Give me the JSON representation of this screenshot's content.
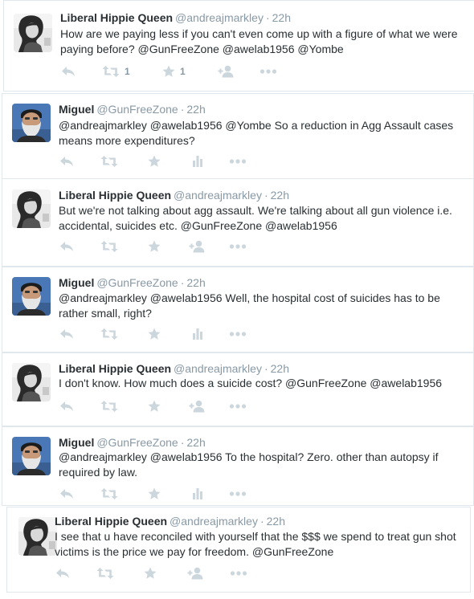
{
  "colors": {
    "name": "#292f33",
    "meta": "#8899a6",
    "action_icon": "#ccd6dd",
    "border": "#e1e8ed"
  },
  "icons": {
    "reply": "reply-icon",
    "retweet": "retweet-icon",
    "favorite": "star-icon",
    "analytics": "bar-chart-icon",
    "follow": "follow-icon",
    "more": "more-icon"
  },
  "tweets": [
    {
      "name": "Liberal Hippie Queen",
      "handle": "@andreajmarkley",
      "dot": "·",
      "time": "22h",
      "text": "How are we paying less if you can't even come up with a figure of what we were paying before? @GunFreeZone @awelab1956 @Yombe",
      "retweet_count": "1",
      "favorite_count": "1"
    },
    {
      "name": "Miguel",
      "handle": "@GunFreeZone",
      "dot": "·",
      "time": "22h",
      "text": "@andreajmarkley @awelab1956 @Yombe So a reduction in Agg Assault cases means more expenditures?"
    },
    {
      "name": "Liberal Hippie Queen",
      "handle": "@andreajmarkley",
      "dot": "·",
      "time": "22h",
      "text": "But we're not talking about agg assault. We're talking about all gun violence i.e. accidental, suicides etc. @GunFreeZone @awelab1956"
    },
    {
      "name": "Miguel",
      "handle": "@GunFreeZone",
      "dot": "·",
      "time": "22h",
      "text": "@andreajmarkley @awelab1956 Well, the hospital cost of suicides has to be rather small, right?"
    },
    {
      "name": "Liberal Hippie Queen",
      "handle": "@andreajmarkley",
      "dot": "·",
      "time": "22h",
      "text": "I don't know. How much does a suicide cost? @GunFreeZone @awelab1956"
    },
    {
      "name": "Miguel",
      "handle": "@GunFreeZone",
      "dot": "·",
      "time": "22h",
      "text": "@andreajmarkley @awelab1956 To the hospital? Zero. other than autopsy if required by law."
    },
    {
      "name": "Liberal Hippie Queen",
      "handle": "@andreajmarkley",
      "dot": "·",
      "time": "22h",
      "text": "I see that u have reconciled with yourself that the $$$ we spend to treat gun shot victims is the price we pay for freedom. @GunFreeZone"
    }
  ]
}
